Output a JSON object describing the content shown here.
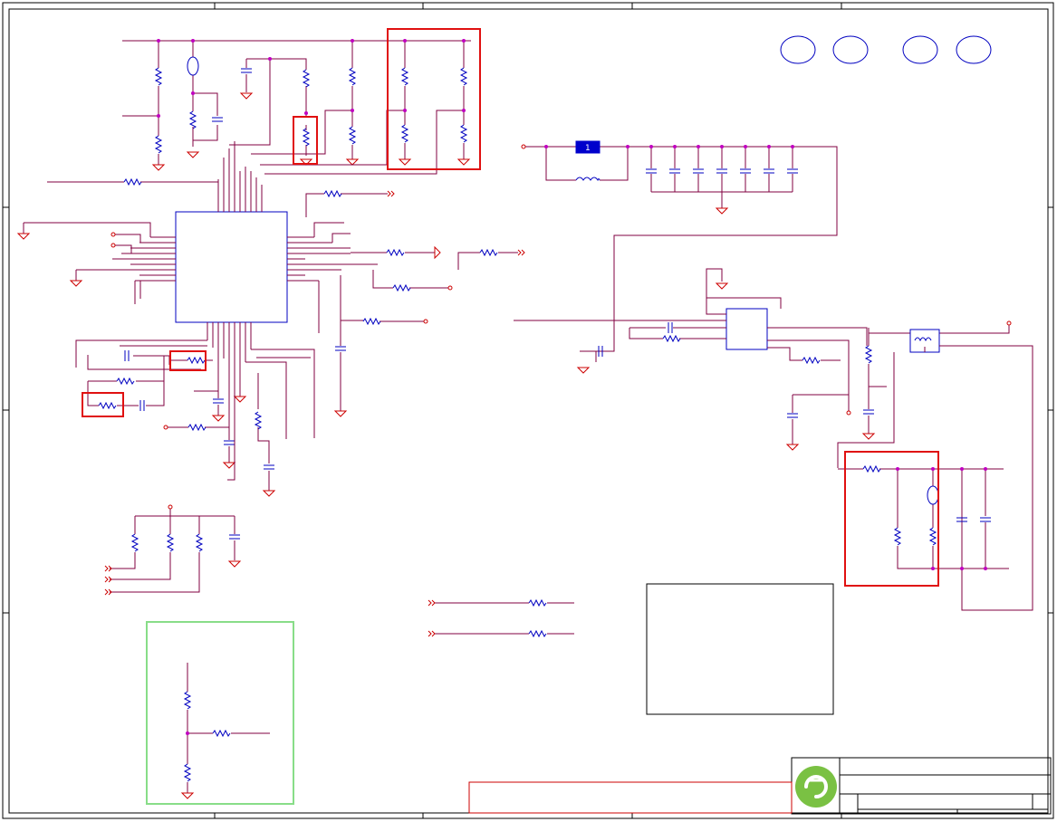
{
  "schematic": {
    "fuse_label": "1",
    "colors": {
      "wire": "#800040",
      "component": "#0000c0",
      "power_symbol": "#cc0000",
      "highlight_box": "#e01010",
      "callout_box": "#88dd88",
      "junction": "#c000c0"
    }
  },
  "title_block": {
    "logo": "green-circle-logo"
  }
}
